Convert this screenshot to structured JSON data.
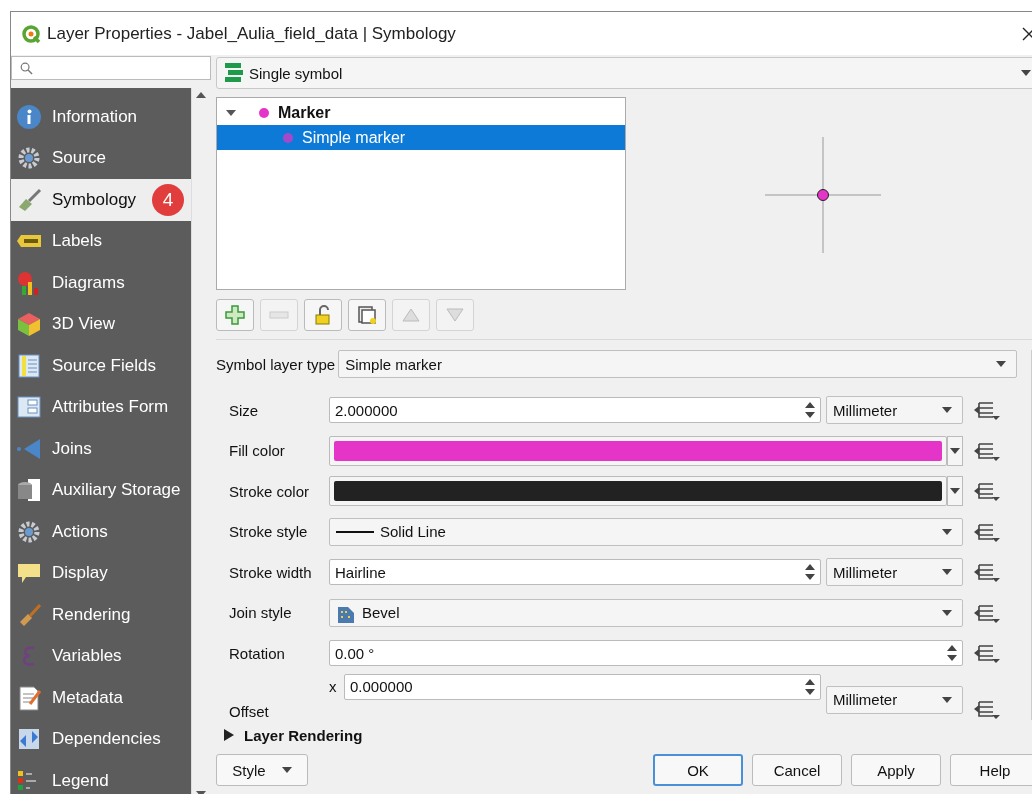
{
  "window": {
    "title": "Layer Properties - Jabel_Aulia_field_data | Symbology"
  },
  "sidebar": {
    "items": [
      {
        "label": "Information",
        "selected": false
      },
      {
        "label": "Source",
        "selected": false
      },
      {
        "label": "Symbology",
        "selected": true,
        "badge": "4"
      },
      {
        "label": "Labels",
        "selected": false
      },
      {
        "label": "Diagrams",
        "selected": false
      },
      {
        "label": "3D View",
        "selected": false
      },
      {
        "label": "Source Fields",
        "selected": false
      },
      {
        "label": "Attributes Form",
        "selected": false
      },
      {
        "label": "Joins",
        "selected": false
      },
      {
        "label": "Auxiliary Storage",
        "selected": false
      },
      {
        "label": "Actions",
        "selected": false
      },
      {
        "label": "Display",
        "selected": false
      },
      {
        "label": "Rendering",
        "selected": false
      },
      {
        "label": "Variables",
        "selected": false
      },
      {
        "label": "Metadata",
        "selected": false
      },
      {
        "label": "Dependencies",
        "selected": false
      },
      {
        "label": "Legend",
        "selected": false
      }
    ]
  },
  "renderer": {
    "value": "Single symbol"
  },
  "symbol_tree": {
    "items": [
      {
        "label": "Marker",
        "expanded": true,
        "selected": false,
        "children": [
          {
            "label": "Simple marker",
            "selected": true
          }
        ]
      }
    ]
  },
  "symbol_toolbar": [
    {
      "disabled": false
    },
    {
      "disabled": true
    },
    {
      "disabled": false
    },
    {
      "disabled": false
    },
    {
      "disabled": true
    },
    {
      "disabled": true
    }
  ],
  "symbol_layer_type": {
    "label": "Symbol layer type",
    "value": "Simple marker"
  },
  "rows": [
    {
      "kind": "spin_unit",
      "label": "Size",
      "value": "2.000000",
      "unit": "Millimeter"
    },
    {
      "kind": "color",
      "label": "Fill color",
      "color": "#e535c8"
    },
    {
      "kind": "color",
      "label": "Stroke color",
      "color": "#222222"
    },
    {
      "kind": "line_combo",
      "label": "Stroke style",
      "value": "Solid Line"
    },
    {
      "kind": "spin_unit",
      "label": "Stroke width",
      "value": "Hairline",
      "unit": "Millimeter"
    },
    {
      "kind": "icon_combo",
      "label": "Join style",
      "value": "Bevel"
    },
    {
      "kind": "spin",
      "label": "Rotation",
      "value": "0.00 °"
    },
    {
      "kind": "offset",
      "label": "Offset",
      "axis": "x",
      "value": "0.000000",
      "unit": "Millimeter"
    }
  ],
  "layer_rendering": {
    "label": "Layer Rendering",
    "expanded": false
  },
  "style_button": {
    "label": "Style"
  },
  "buttons": [
    {
      "label": "OK",
      "default": true
    },
    {
      "label": "Cancel",
      "default": false
    },
    {
      "label": "Apply",
      "default": false
    },
    {
      "label": "Help",
      "default": false
    }
  ]
}
